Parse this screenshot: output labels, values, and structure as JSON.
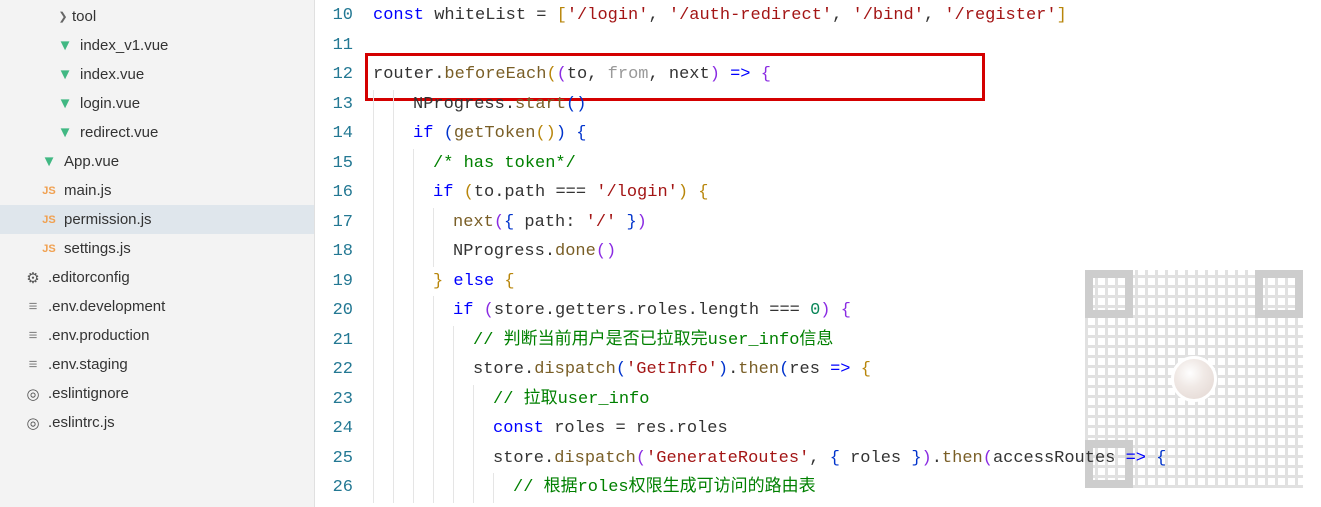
{
  "sidebar": {
    "items": [
      {
        "label": "tool",
        "icon": "chevron",
        "indent": 3,
        "selected": false
      },
      {
        "label": "index_v1.vue",
        "icon": "vue",
        "indent": 3,
        "selected": false
      },
      {
        "label": "index.vue",
        "icon": "vue",
        "indent": 3,
        "selected": false
      },
      {
        "label": "login.vue",
        "icon": "vue",
        "indent": 3,
        "selected": false
      },
      {
        "label": "redirect.vue",
        "icon": "vue",
        "indent": 3,
        "selected": false
      },
      {
        "label": "App.vue",
        "icon": "vue",
        "indent": 2,
        "selected": false
      },
      {
        "label": "main.js",
        "icon": "js",
        "indent": 2,
        "selected": false
      },
      {
        "label": "permission.js",
        "icon": "js",
        "indent": 2,
        "selected": true
      },
      {
        "label": "settings.js",
        "icon": "js",
        "indent": 2,
        "selected": false
      },
      {
        "label": ".editorconfig",
        "icon": "gear",
        "indent": 1,
        "selected": false
      },
      {
        "label": ".env.development",
        "icon": "lines",
        "indent": 1,
        "selected": false
      },
      {
        "label": ".env.production",
        "icon": "lines",
        "indent": 1,
        "selected": false
      },
      {
        "label": ".env.staging",
        "icon": "lines",
        "indent": 1,
        "selected": false
      },
      {
        "label": ".eslintignore",
        "icon": "target",
        "indent": 1,
        "selected": false
      },
      {
        "label": ".eslintrc.js",
        "icon": "target",
        "indent": 1,
        "selected": false
      }
    ]
  },
  "code": {
    "line_numbers": [
      "10",
      "11",
      "12",
      "13",
      "14",
      "15",
      "16",
      "17",
      "18",
      "19",
      "20",
      "21",
      "22",
      "23",
      "24",
      "25",
      "26"
    ],
    "highlight": {
      "line_start": 12,
      "line_end": 12
    },
    "tokens": {
      "l10": [
        {
          "cls": "tok-kw",
          "t": "const"
        },
        {
          "cls": "tok-id",
          "t": " whiteList "
        },
        {
          "cls": "tok-punc",
          "t": "= "
        },
        {
          "cls": "tok-br-y",
          "t": "["
        },
        {
          "cls": "tok-str",
          "t": "'/login'"
        },
        {
          "cls": "tok-punc",
          "t": ", "
        },
        {
          "cls": "tok-str",
          "t": "'/auth-redirect'"
        },
        {
          "cls": "tok-punc",
          "t": ", "
        },
        {
          "cls": "tok-str",
          "t": "'/bind'"
        },
        {
          "cls": "tok-punc",
          "t": ", "
        },
        {
          "cls": "tok-str",
          "t": "'/register'"
        },
        {
          "cls": "tok-br-y",
          "t": "]"
        }
      ],
      "l11": [],
      "l12": [
        {
          "cls": "tok-id",
          "t": "router."
        },
        {
          "cls": "tok-fn",
          "t": "beforeEach"
        },
        {
          "cls": "tok-br-y",
          "t": "("
        },
        {
          "cls": "tok-br-p",
          "t": "("
        },
        {
          "cls": "tok-id",
          "t": "to"
        },
        {
          "cls": "tok-punc",
          "t": ", "
        },
        {
          "cls": "tok-param",
          "t": "from"
        },
        {
          "cls": "tok-punc",
          "t": ", "
        },
        {
          "cls": "tok-id",
          "t": "next"
        },
        {
          "cls": "tok-br-p",
          "t": ")"
        },
        {
          "cls": "tok-kw",
          "t": " => "
        },
        {
          "cls": "tok-br-p",
          "t": "{"
        }
      ],
      "l13": [
        {
          "cls": "tok-id",
          "t": "NProgress."
        },
        {
          "cls": "tok-fn",
          "t": "start"
        },
        {
          "cls": "tok-br-b",
          "t": "("
        },
        {
          "cls": "tok-br-b",
          "t": ")"
        }
      ],
      "l14": [
        {
          "cls": "tok-kw",
          "t": "if"
        },
        {
          "cls": "tok-punc",
          "t": " "
        },
        {
          "cls": "tok-br-b",
          "t": "("
        },
        {
          "cls": "tok-fn",
          "t": "getToken"
        },
        {
          "cls": "tok-br-y",
          "t": "("
        },
        {
          "cls": "tok-br-y",
          "t": ")"
        },
        {
          "cls": "tok-br-b",
          "t": ")"
        },
        {
          "cls": "tok-punc",
          "t": " "
        },
        {
          "cls": "tok-br-b",
          "t": "{"
        }
      ],
      "l15": [
        {
          "cls": "tok-comm",
          "t": "/* has token*/"
        }
      ],
      "l16": [
        {
          "cls": "tok-kw",
          "t": "if"
        },
        {
          "cls": "tok-punc",
          "t": " "
        },
        {
          "cls": "tok-br-y",
          "t": "("
        },
        {
          "cls": "tok-id",
          "t": "to.path "
        },
        {
          "cls": "tok-punc",
          "t": "=== "
        },
        {
          "cls": "tok-str",
          "t": "'/login'"
        },
        {
          "cls": "tok-br-y",
          "t": ")"
        },
        {
          "cls": "tok-punc",
          "t": " "
        },
        {
          "cls": "tok-br-y",
          "t": "{"
        }
      ],
      "l17": [
        {
          "cls": "tok-fn",
          "t": "next"
        },
        {
          "cls": "tok-br-p",
          "t": "("
        },
        {
          "cls": "tok-br-b",
          "t": "{"
        },
        {
          "cls": "tok-id",
          "t": " path"
        },
        {
          "cls": "tok-punc",
          "t": ": "
        },
        {
          "cls": "tok-str",
          "t": "'/'"
        },
        {
          "cls": "tok-punc",
          "t": " "
        },
        {
          "cls": "tok-br-b",
          "t": "}"
        },
        {
          "cls": "tok-br-p",
          "t": ")"
        }
      ],
      "l18": [
        {
          "cls": "tok-id",
          "t": "NProgress."
        },
        {
          "cls": "tok-fn",
          "t": "done"
        },
        {
          "cls": "tok-br-p",
          "t": "("
        },
        {
          "cls": "tok-br-p",
          "t": ")"
        }
      ],
      "l19": [
        {
          "cls": "tok-br-y",
          "t": "}"
        },
        {
          "cls": "tok-punc",
          "t": " "
        },
        {
          "cls": "tok-kw",
          "t": "else"
        },
        {
          "cls": "tok-punc",
          "t": " "
        },
        {
          "cls": "tok-br-y",
          "t": "{"
        }
      ],
      "l20": [
        {
          "cls": "tok-kw",
          "t": "if"
        },
        {
          "cls": "tok-punc",
          "t": " "
        },
        {
          "cls": "tok-br-p",
          "t": "("
        },
        {
          "cls": "tok-id",
          "t": "store.getters.roles.length "
        },
        {
          "cls": "tok-punc",
          "t": "=== "
        },
        {
          "cls": "tok-num",
          "t": "0"
        },
        {
          "cls": "tok-br-p",
          "t": ")"
        },
        {
          "cls": "tok-punc",
          "t": " "
        },
        {
          "cls": "tok-br-p",
          "t": "{"
        }
      ],
      "l21": [
        {
          "cls": "tok-comm",
          "t": "// 判断当前用户是否已拉取完user_info信息"
        }
      ],
      "l22": [
        {
          "cls": "tok-id",
          "t": "store."
        },
        {
          "cls": "tok-fn",
          "t": "dispatch"
        },
        {
          "cls": "tok-br-b",
          "t": "("
        },
        {
          "cls": "tok-str",
          "t": "'GetInfo'"
        },
        {
          "cls": "tok-br-b",
          "t": ")"
        },
        {
          "cls": "tok-punc",
          "t": "."
        },
        {
          "cls": "tok-fn",
          "t": "then"
        },
        {
          "cls": "tok-br-b",
          "t": "("
        },
        {
          "cls": "tok-id",
          "t": "res "
        },
        {
          "cls": "tok-kw",
          "t": "=>"
        },
        {
          "cls": "tok-punc",
          "t": " "
        },
        {
          "cls": "tok-br-y",
          "t": "{"
        }
      ],
      "l23": [
        {
          "cls": "tok-comm",
          "t": "// 拉取user_info"
        }
      ],
      "l24": [
        {
          "cls": "tok-kw",
          "t": "const"
        },
        {
          "cls": "tok-id",
          "t": " roles "
        },
        {
          "cls": "tok-punc",
          "t": "= "
        },
        {
          "cls": "tok-id",
          "t": "res.roles"
        }
      ],
      "l25": [
        {
          "cls": "tok-id",
          "t": "store."
        },
        {
          "cls": "tok-fn",
          "t": "dispatch"
        },
        {
          "cls": "tok-br-p",
          "t": "("
        },
        {
          "cls": "tok-str",
          "t": "'GenerateRoutes'"
        },
        {
          "cls": "tok-punc",
          "t": ", "
        },
        {
          "cls": "tok-br-b",
          "t": "{"
        },
        {
          "cls": "tok-id",
          "t": " roles "
        },
        {
          "cls": "tok-br-b",
          "t": "}"
        },
        {
          "cls": "tok-br-p",
          "t": ")"
        },
        {
          "cls": "tok-punc",
          "t": "."
        },
        {
          "cls": "tok-fn",
          "t": "then"
        },
        {
          "cls": "tok-br-p",
          "t": "("
        },
        {
          "cls": "tok-id",
          "t": "accessRoutes "
        },
        {
          "cls": "tok-kw",
          "t": "=>"
        },
        {
          "cls": "tok-punc",
          "t": " "
        },
        {
          "cls": "tok-br-b",
          "t": "{"
        }
      ],
      "l26": [
        {
          "cls": "tok-comm",
          "t": "// 根据roles权限生成可访问的路由表"
        }
      ]
    },
    "indents": {
      "l10": 0,
      "l11": 0,
      "l12": 0,
      "l13": 2,
      "l14": 2,
      "l15": 3,
      "l16": 3,
      "l17": 4,
      "l18": 4,
      "l19": 3,
      "l20": 4,
      "l21": 5,
      "l22": 5,
      "l23": 6,
      "l24": 6,
      "l25": 6,
      "l26": 7
    }
  }
}
